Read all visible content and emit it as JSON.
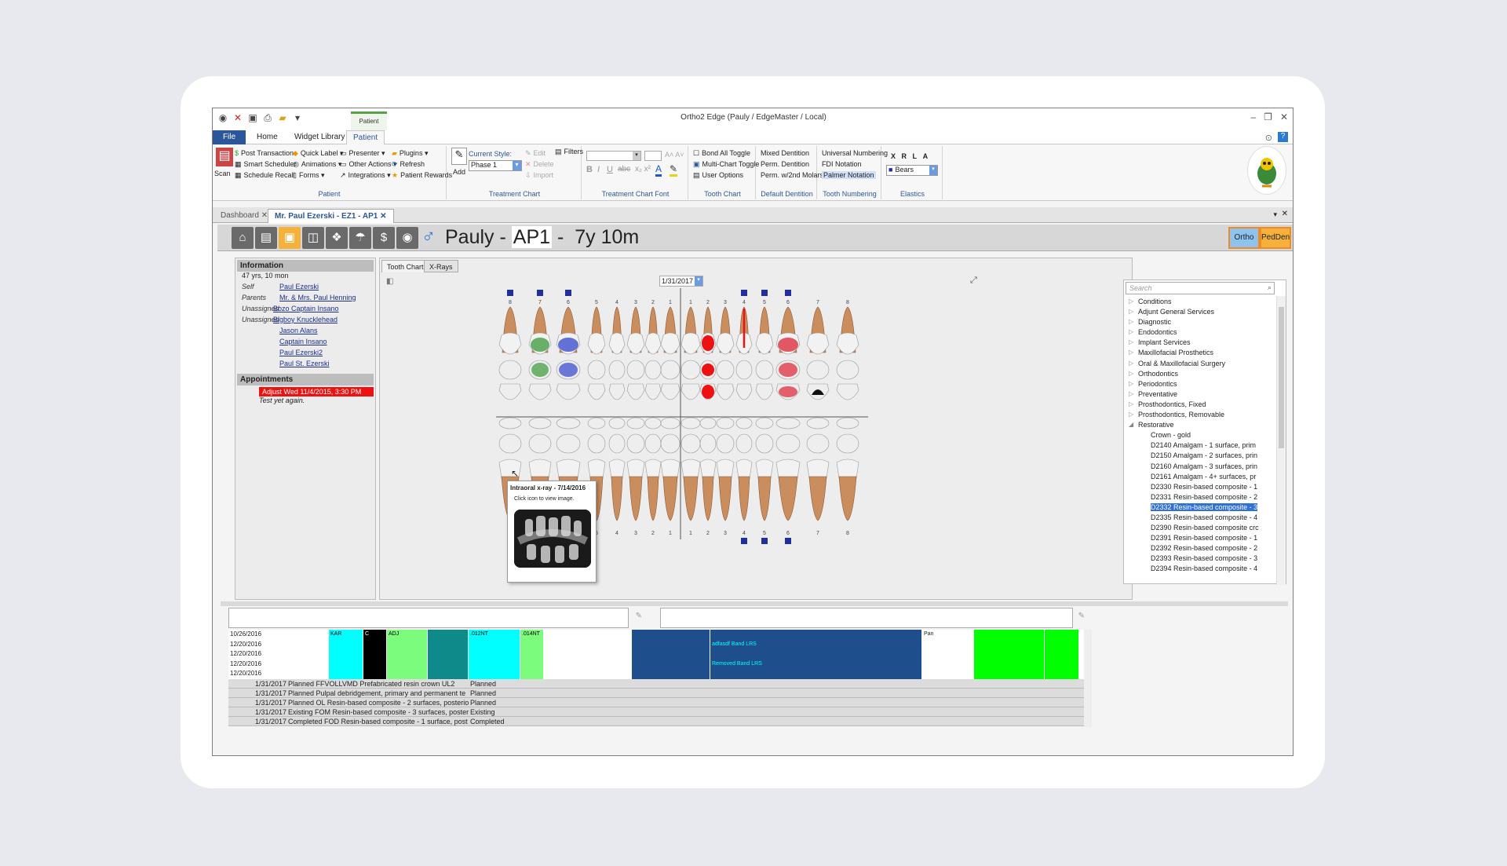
{
  "window": {
    "title": "Ortho2 Edge (Pauly / EdgeMaster / Local)",
    "context_tab": "Patient"
  },
  "ribbon": {
    "tabs": [
      "File",
      "Home",
      "Widget Library",
      "Patient"
    ],
    "patient_group": {
      "label": "Patient",
      "scan": "Scan",
      "items": [
        "Post Transaction",
        "Smart Scheduler",
        "Schedule Recall",
        "Quick Label",
        "Animations",
        "Forms",
        "Presenter",
        "Other Actions",
        "Integrations",
        "Plugins",
        "Refresh",
        "Patient Rewards"
      ]
    },
    "treatment_chart": {
      "label": "Treatment Chart",
      "add": "Add",
      "current_style": "Current Style:",
      "style_value": "Phase 1",
      "edit": "Edit",
      "delete": "Delete",
      "import": "Import",
      "filters": "Filters"
    },
    "font_group": {
      "label": "Treatment Chart Font"
    },
    "tooth_chart": {
      "label": "Tooth Chart",
      "items": [
        "Bond All Toggle",
        "Multi-Chart Toggle",
        "User Options"
      ]
    },
    "default_dentition": {
      "label": "Default Dentition",
      "items": [
        "Mixed Dentition",
        "Perm. Dentition",
        "Perm. w/2nd Molars"
      ]
    },
    "tooth_numbering": {
      "label": "Tooth Numbering",
      "items": [
        "Universal Numbering",
        "FDI Notation",
        "Palmer Notation"
      ]
    },
    "elastics": {
      "label": "Elastics",
      "letters": [
        "X",
        "R",
        "L",
        "A"
      ],
      "value": "Bears"
    }
  },
  "doc_tabs": [
    "Dashboard",
    "Mr. Paul Ezerski - EZ1 - AP1"
  ],
  "patient": {
    "name": "Pauly -",
    "code": "AP1",
    "suffix": "-",
    "age": "7y 10m",
    "btn_ortho": "Ortho",
    "btn_ped": "PedDen"
  },
  "info": {
    "header": "Information",
    "age": "47 yrs, 10 mon",
    "rows": [
      {
        "k": "Self",
        "v": "Paul Ezerski"
      },
      {
        "k": "Parents",
        "v": "Mr. & Mrs. Paul Henning"
      },
      {
        "k": "Unassigned",
        "v": "Bozo Captain Insano"
      },
      {
        "k": "Unassigned",
        "v": "Bigboy Knucklehead"
      },
      {
        "k": "",
        "v": "Jason Alans"
      },
      {
        "k": "",
        "v": "Captain Insano"
      },
      {
        "k": "",
        "v": "Paul Ezerski2"
      },
      {
        "k": "",
        "v": "Paul St. Ezerski"
      }
    ],
    "appt_header": "Appointments",
    "appt": "Adjust   Wed 11/4/2015, 3:30 PM",
    "appt_note": "Test  yet again."
  },
  "chart": {
    "tabs": [
      "Tooth Chart",
      "X-Rays"
    ],
    "date": "1/31/2017",
    "upper_nums": [
      "8",
      "7",
      "6",
      "5",
      "4",
      "3",
      "2",
      "1",
      "1",
      "2",
      "3",
      "4",
      "5",
      "6",
      "7",
      "8"
    ],
    "lower_nums": [
      "8",
      "7",
      "6",
      "5",
      "4",
      "3",
      "2",
      "1",
      "1",
      "2",
      "3",
      "4",
      "5",
      "6",
      "7",
      "8"
    ]
  },
  "tooltip": {
    "title": "Intraoral x-ray - 7/14/2016",
    "sub": "Click icon to view image."
  },
  "tree": {
    "search": "Search",
    "nodes": [
      "Conditions",
      "Adjunt General Services",
      "Diagnostic",
      "Endodontics",
      "Implant Services",
      "Maxillofacial Prosthetics",
      "Oral & Maxillofacial Surgery",
      "Orthodontics",
      "Periodontics",
      "Preventative",
      "Prosthodontics, Fixed",
      "Prosthodontics, Removable",
      "Restorative"
    ],
    "children": [
      "Crown - gold",
      "D2140  Amalgam - 1 surface, prim",
      "D2150  Amalgam - 2 surfaces, prin",
      "D2160  Amalgam - 3 surfaces, prin",
      "D2161  Amalgam - 4+ surfaces, pr",
      "D2330  Resin-based composite - 1",
      "D2331  Resin-based composite - 2",
      "D2332  Resin-based composite - 3",
      "D2335  Resin-based composite - 4",
      "D2390  Resin-based composite crc",
      "D2391  Resin-based composite - 1",
      "D2392  Resin-based composite - 2",
      "D2393  Resin-based composite - 3",
      "D2394  Resin-based composite - 4"
    ],
    "selected_index": 7
  },
  "grid": {
    "dates": [
      "10/26/2016",
      "12/20/2016",
      "12/20/2016",
      "12/20/2016",
      "12/20/2016",
      "12/20/2016"
    ],
    "row0": [
      "KAR",
      "C",
      "ADJ",
      "",
      ".012NT",
      ".014NT"
    ],
    "pan": "Pan",
    "notes": [
      "adfasdf   Band LRS",
      "Removed Band LRS"
    ]
  },
  "treatments": [
    {
      "date": "1/31/2017",
      "desc": "Planned FFVOLLVMD Prefabricated resin crown UL2",
      "status": "Planned"
    },
    {
      "date": "1/31/2017",
      "desc": "Planned Pulpal debridgement, primary and permanent te",
      "status": "Planned"
    },
    {
      "date": "1/31/2017",
      "desc": "Planned OL Resin-based composite - 2 surfaces, posterio",
      "status": "Planned"
    },
    {
      "date": "1/31/2017",
      "desc": "Existing FOM Resin-based composite - 3 surfaces, poster",
      "status": "Existing"
    },
    {
      "date": "1/31/2017",
      "desc": "Completed FOD Resin-based composite - 1 surface, post",
      "status": "Completed"
    }
  ],
  "colors": {
    "accent": "#2b579a",
    "orange": "#f08a24",
    "selected": "#3071d9",
    "cyan": "#00ffff",
    "green": "#7cfc7c",
    "teal": "#0f8a8a",
    "navy": "#1f4e8c",
    "lime": "#00ff00",
    "red": "#e11111"
  }
}
